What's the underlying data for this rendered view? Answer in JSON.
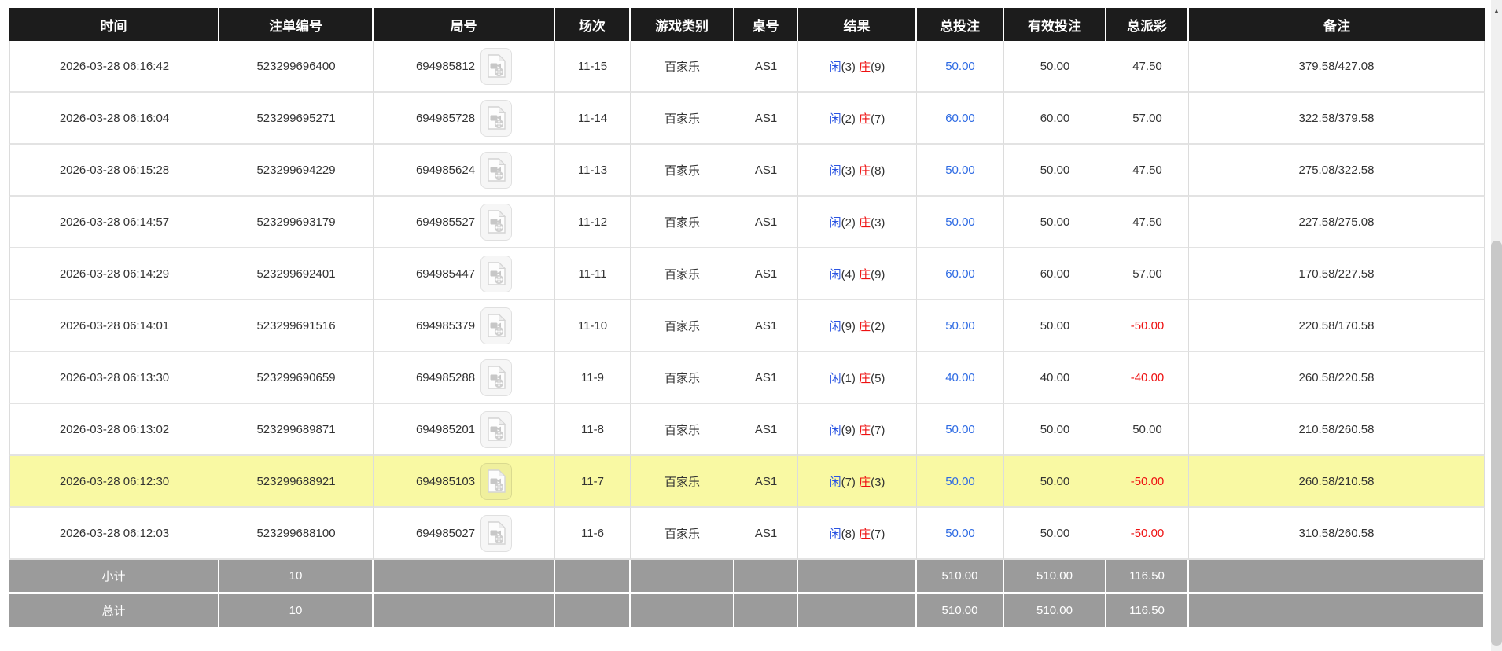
{
  "columns": [
    {
      "key": "time",
      "label": "时间"
    },
    {
      "key": "bet_id",
      "label": "注单编号"
    },
    {
      "key": "round",
      "label": "局号"
    },
    {
      "key": "session",
      "label": "场次"
    },
    {
      "key": "game",
      "label": "游戏类别"
    },
    {
      "key": "table_no",
      "label": "桌号"
    },
    {
      "key": "result",
      "label": "结果"
    },
    {
      "key": "total_bet",
      "label": "总投注"
    },
    {
      "key": "valid_bet",
      "label": "有效投注"
    },
    {
      "key": "payout",
      "label": "总派彩"
    },
    {
      "key": "remark",
      "label": "备注"
    }
  ],
  "result_labels": {
    "player": "闲",
    "banker": "庄"
  },
  "rows": [
    {
      "time": "2026-03-28 06:16:42",
      "bet_id": "523299696400",
      "round": "694985812",
      "session": "11-15",
      "game": "百家乐",
      "table_no": "AS1",
      "player": "3",
      "banker": "9",
      "total_bet": "50.00",
      "valid_bet": "50.00",
      "payout": "47.50",
      "remark": "379.58/427.08",
      "highlight": false
    },
    {
      "time": "2026-03-28 06:16:04",
      "bet_id": "523299695271",
      "round": "694985728",
      "session": "11-14",
      "game": "百家乐",
      "table_no": "AS1",
      "player": "2",
      "banker": "7",
      "total_bet": "60.00",
      "valid_bet": "60.00",
      "payout": "57.00",
      "remark": "322.58/379.58",
      "highlight": false
    },
    {
      "time": "2026-03-28 06:15:28",
      "bet_id": "523299694229",
      "round": "694985624",
      "session": "11-13",
      "game": "百家乐",
      "table_no": "AS1",
      "player": "3",
      "banker": "8",
      "total_bet": "50.00",
      "valid_bet": "50.00",
      "payout": "47.50",
      "remark": "275.08/322.58",
      "highlight": false
    },
    {
      "time": "2026-03-28 06:14:57",
      "bet_id": "523299693179",
      "round": "694985527",
      "session": "11-12",
      "game": "百家乐",
      "table_no": "AS1",
      "player": "2",
      "banker": "3",
      "total_bet": "50.00",
      "valid_bet": "50.00",
      "payout": "47.50",
      "remark": "227.58/275.08",
      "highlight": false
    },
    {
      "time": "2026-03-28 06:14:29",
      "bet_id": "523299692401",
      "round": "694985447",
      "session": "11-11",
      "game": "百家乐",
      "table_no": "AS1",
      "player": "4",
      "banker": "9",
      "total_bet": "60.00",
      "valid_bet": "60.00",
      "payout": "57.00",
      "remark": "170.58/227.58",
      "highlight": false
    },
    {
      "time": "2026-03-28 06:14:01",
      "bet_id": "523299691516",
      "round": "694985379",
      "session": "11-10",
      "game": "百家乐",
      "table_no": "AS1",
      "player": "9",
      "banker": "2",
      "total_bet": "50.00",
      "valid_bet": "50.00",
      "payout": "-50.00",
      "remark": "220.58/170.58",
      "highlight": false
    },
    {
      "time": "2026-03-28 06:13:30",
      "bet_id": "523299690659",
      "round": "694985288",
      "session": "11-9",
      "game": "百家乐",
      "table_no": "AS1",
      "player": "1",
      "banker": "5",
      "total_bet": "40.00",
      "valid_bet": "40.00",
      "payout": "-40.00",
      "remark": "260.58/220.58",
      "highlight": false
    },
    {
      "time": "2026-03-28 06:13:02",
      "bet_id": "523299689871",
      "round": "694985201",
      "session": "11-8",
      "game": "百家乐",
      "table_no": "AS1",
      "player": "9",
      "banker": "7",
      "total_bet": "50.00",
      "valid_bet": "50.00",
      "payout": "50.00",
      "remark": "210.58/260.58",
      "highlight": false
    },
    {
      "time": "2026-03-28 06:12:30",
      "bet_id": "523299688921",
      "round": "694985103",
      "session": "11-7",
      "game": "百家乐",
      "table_no": "AS1",
      "player": "7",
      "banker": "3",
      "total_bet": "50.00",
      "valid_bet": "50.00",
      "payout": "-50.00",
      "remark": "260.58/210.58",
      "highlight": true
    },
    {
      "time": "2026-03-28 06:12:03",
      "bet_id": "523299688100",
      "round": "694985027",
      "session": "11-6",
      "game": "百家乐",
      "table_no": "AS1",
      "player": "8",
      "banker": "7",
      "total_bet": "50.00",
      "valid_bet": "50.00",
      "payout": "-50.00",
      "remark": "310.58/260.58",
      "highlight": false
    }
  ],
  "summary_rows": [
    {
      "label": "小计",
      "count": "10",
      "total_bet": "510.00",
      "valid_bet": "510.00",
      "payout": "116.50"
    },
    {
      "label": "总计",
      "count": "10",
      "total_bet": "510.00",
      "valid_bet": "510.00",
      "payout": "116.50"
    }
  ],
  "scrollbar": {
    "up_arrow": "▲"
  },
  "colors": {
    "header_bg": "#1c1c1c",
    "highlight_row": "#f9f9a3",
    "summary_bg": "#9b9b9b",
    "player_blue": "#2b55e2",
    "banker_red": "#ee1111",
    "amount_blue": "#2d6ae3",
    "loss_red": "#ee1111"
  }
}
